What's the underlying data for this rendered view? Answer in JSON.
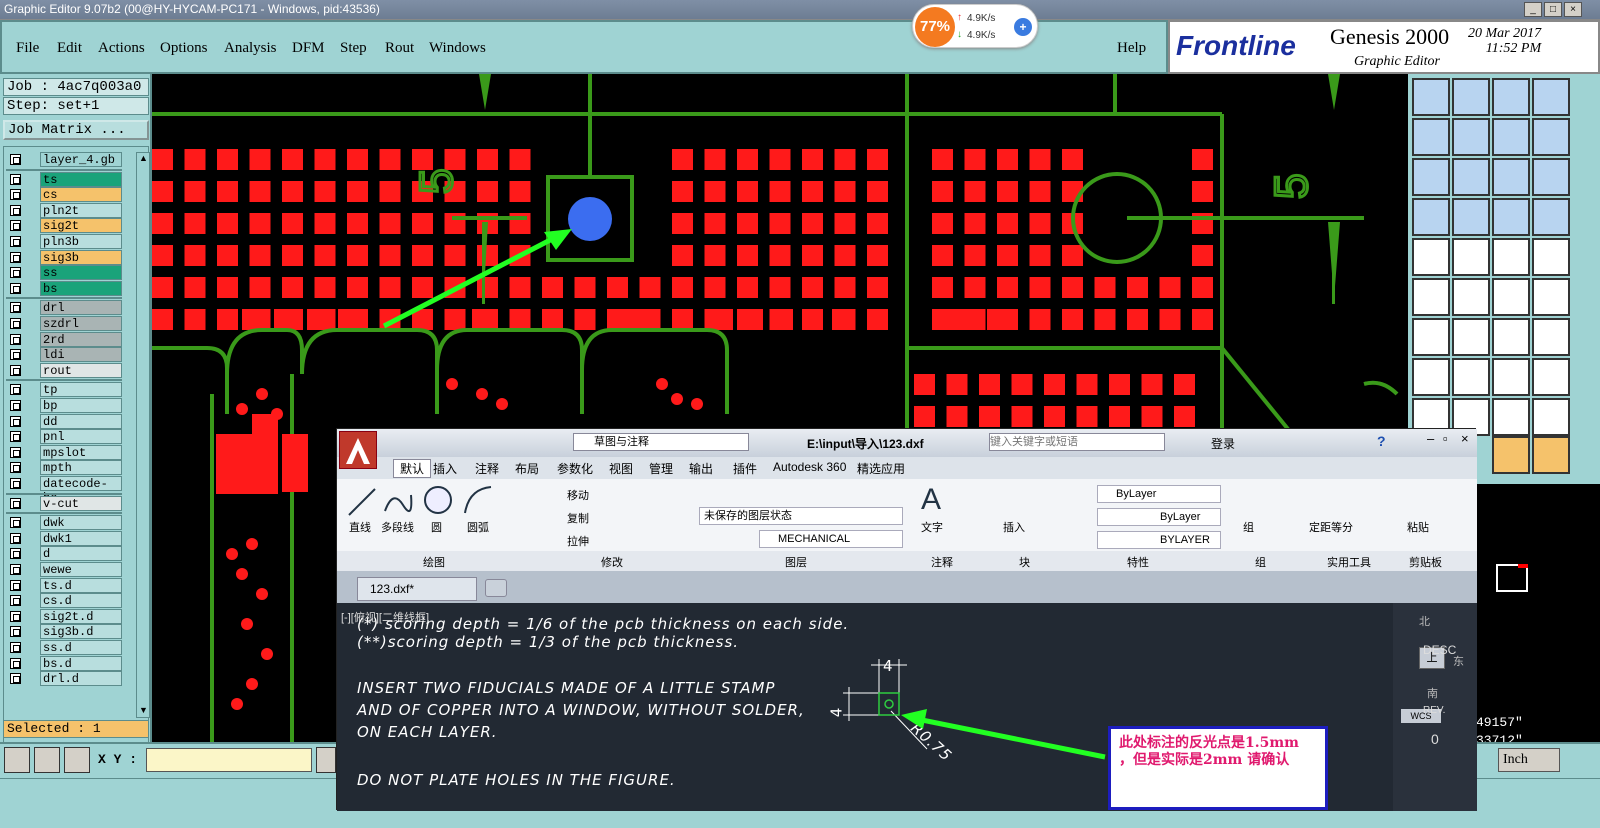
{
  "titlebar": {
    "title": "Graphic Editor 9.07b2 (00@HY-HYCAM-PC171 - Windows, pid:43536)"
  },
  "speed": {
    "percent": "77%",
    "up": "4.9K/s",
    "down": "4.9K/s"
  },
  "menu": [
    "File",
    "Edit",
    "Actions",
    "Options",
    "Analysis",
    "DFM",
    "Step",
    "Rout",
    "Windows"
  ],
  "help": "Help",
  "brand": {
    "logo": "Frontline",
    "product": "Genesis 2000",
    "subtitle": "Graphic Editor",
    "date": "20 Mar 2017",
    "time": "11:52 PM"
  },
  "job": {
    "job": "Job : 4ac7q003a0",
    "step": "Step: set+1",
    "matrix": "Job Matrix ..."
  },
  "layers": [
    {
      "name": "layer_4.gb",
      "color": "#9fd3d3"
    },
    {
      "name": "ts",
      "color": "#1aa37a"
    },
    {
      "name": "cs",
      "color": "#f5c26b"
    },
    {
      "name": "pln2t",
      "color": "#b8dede"
    },
    {
      "name": "sig2t",
      "color": "#f5c26b"
    },
    {
      "name": "pln3b",
      "color": "#b8dede"
    },
    {
      "name": "sig3b",
      "color": "#f5c26b"
    },
    {
      "name": "ss",
      "color": "#1aa37a"
    },
    {
      "name": "bs",
      "color": "#1aa37a"
    },
    {
      "name": "drl",
      "color": "#a9b4b4"
    },
    {
      "name": "szdrl",
      "color": "#a9b4b4"
    },
    {
      "name": "2rd",
      "color": "#a9b4b4"
    },
    {
      "name": "ldi",
      "color": "#a9b4b4"
    },
    {
      "name": "rout",
      "color": "#e0e6e6"
    },
    {
      "name": "tp",
      "color": "#b8dede"
    },
    {
      "name": "bp",
      "color": "#b8dede"
    },
    {
      "name": "dd",
      "color": "#b8dede"
    },
    {
      "name": "pnl",
      "color": "#b8dede"
    },
    {
      "name": "mpslot",
      "color": "#b8dede"
    },
    {
      "name": "mpth",
      "color": "#b8dede"
    },
    {
      "name": "datecode-bs",
      "color": "#b8dede"
    },
    {
      "name": "v-cut",
      "color": "#e0e6e6"
    },
    {
      "name": "dwk",
      "color": "#b8dede"
    },
    {
      "name": "dwk1",
      "color": "#b8dede"
    },
    {
      "name": "d",
      "color": "#b8dede"
    },
    {
      "name": "wewe",
      "color": "#b8dede"
    },
    {
      "name": "ts.d",
      "color": "#b8dede"
    },
    {
      "name": "cs.d",
      "color": "#b8dede"
    },
    {
      "name": "sig2t.d",
      "color": "#b8dede"
    },
    {
      "name": "sig3b.d",
      "color": "#b8dede"
    },
    {
      "name": "ss.d",
      "color": "#b8dede"
    },
    {
      "name": "bs.d",
      "color": "#b8dede"
    },
    {
      "name": "drl.d",
      "color": "#b8dede"
    }
  ],
  "selected": "Selected : 1",
  "xy_label": "X Y :",
  "coords": {
    "x": "49157\"",
    "y": "33712\""
  },
  "units": "Inch",
  "acad": {
    "search_placeholder": "键入关键字或短语",
    "workspace": "草图与注释",
    "file_title": "E:\\input\\导入\\123.dxf",
    "login": "登录",
    "tabs": [
      "默认",
      "插入",
      "注释",
      "布局",
      "参数化",
      "视图",
      "管理",
      "输出",
      "插件",
      "Autodesk 360",
      "精选应用"
    ],
    "draw": [
      "直线",
      "多段线",
      "圆",
      "圆弧"
    ],
    "modify": [
      "移动",
      "复制",
      "拉伸"
    ],
    "layer_state": "未保存的图层状态",
    "layer_name": "MECHANICAL",
    "text_label": "文字",
    "insert_label": "插入",
    "bylayer": "ByLayer",
    "bylayer2": "ByLayer",
    "bylayer3": "BYLAYER",
    "group_label": "组",
    "measure_label": "定距等分",
    "paste_label": "粘贴",
    "panels": [
      "绘图",
      "修改",
      "图层",
      "注释",
      "块",
      "特性",
      "组",
      "实用工具",
      "剪贴板"
    ],
    "doc_tab": "123.dxf*",
    "viewport_label": "[-][俯视][二维线框]",
    "lines": [
      "(*) scoring depth = 1/6 of the pcb thickness on each side.",
      "(**)scoring depth = 1/3 of the pcb thickness.",
      "INSERT TWO FIDUCIALS MADE OF A LITTLE STAMP",
      "AND OF COPPER INTO A WINDOW, WITHOUT SOLDER,",
      "ON EACH LAYER.",
      "DO NOT PLATE HOLES IN THE FIGURE."
    ],
    "dim_top": "4",
    "dim_left": "4",
    "dim_radius": "R0.75",
    "viewcube": {
      "north": "北",
      "top": "上",
      "east": "东",
      "south": "南",
      "wcs": "WCS",
      "desc": "DESC",
      "rev": "REV.",
      "zero": "0"
    }
  },
  "note": {
    "line1": "此处标注的反光点是1.5mm",
    "line2": "，但是实际是2mm  请确认"
  },
  "colors": {
    "pad_red": "#ff1a1a",
    "trace_green": "#3a9a1a",
    "panel_teal": "#9fd3d3",
    "arrow_green": "#22ff22",
    "highlight_blue": "#3b6df0"
  }
}
